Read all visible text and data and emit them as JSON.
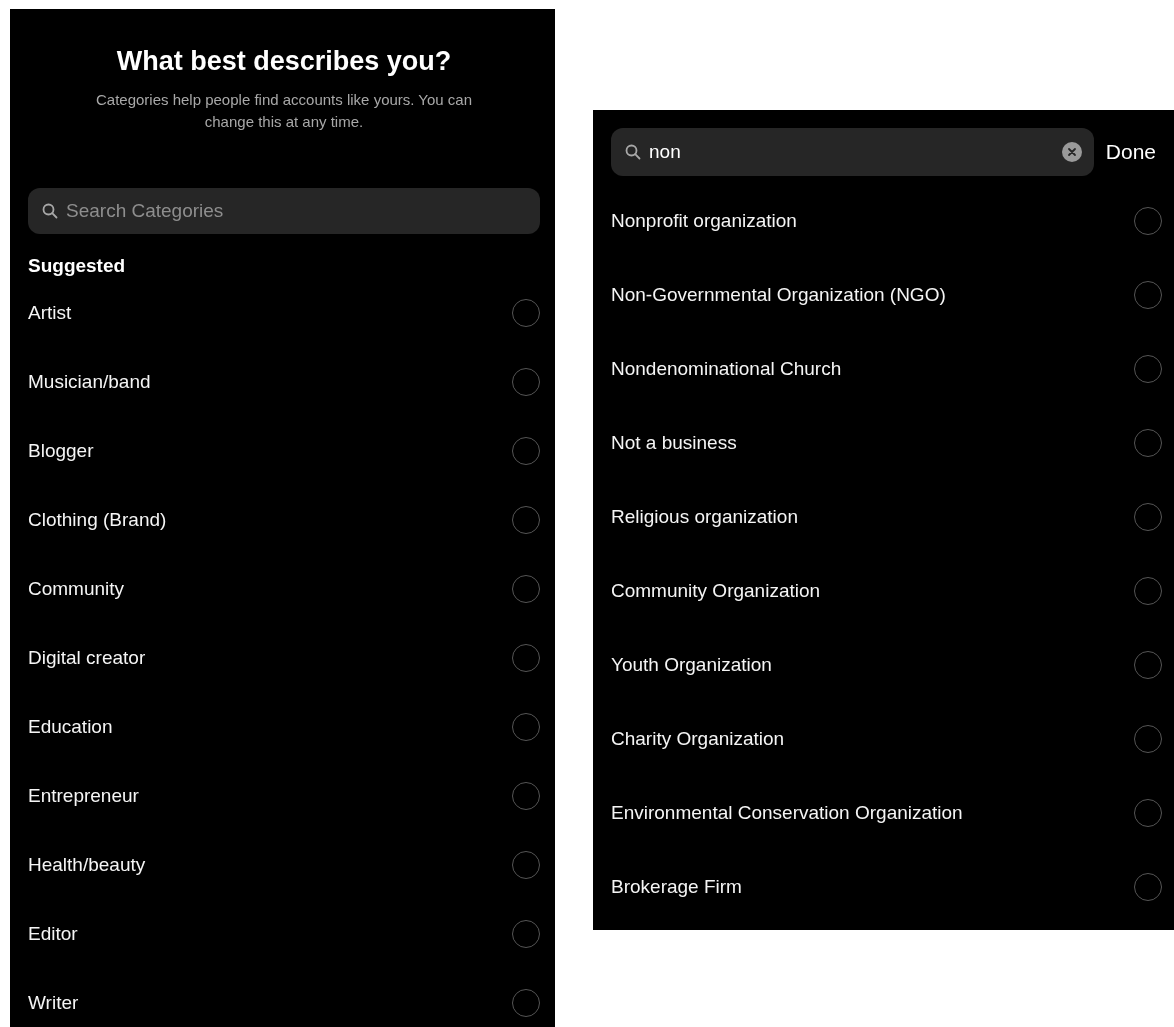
{
  "screens": [
    {
      "title": "What best describes you?",
      "subtitle": "Categories help people find accounts like yours. You can change this at any time.",
      "search": {
        "placeholder": "Search Categories"
      },
      "section_header": "Suggested",
      "options": [
        {
          "label": "Artist",
          "selected": false
        },
        {
          "label": "Musician/band",
          "selected": false
        },
        {
          "label": "Blogger",
          "selected": false
        },
        {
          "label": "Clothing (Brand)",
          "selected": false
        },
        {
          "label": "Community",
          "selected": false
        },
        {
          "label": "Digital creator",
          "selected": false
        },
        {
          "label": "Education",
          "selected": false
        },
        {
          "label": "Entrepreneur",
          "selected": false
        },
        {
          "label": "Health/beauty",
          "selected": false
        },
        {
          "label": "Editor",
          "selected": false
        },
        {
          "label": "Writer",
          "selected": false
        }
      ]
    },
    {
      "search": {
        "value": "non"
      },
      "done_button": "Done",
      "options": [
        {
          "label": "Nonprofit organization",
          "selected": false
        },
        {
          "label": "Non-Governmental Organization (NGO)",
          "selected": false
        },
        {
          "label": "Nondenominational Church",
          "selected": false
        },
        {
          "label": "Not a business",
          "selected": false
        },
        {
          "label": "Religious organization",
          "selected": false
        },
        {
          "label": "Community Organization",
          "selected": false
        },
        {
          "label": "Youth Organization",
          "selected": false
        },
        {
          "label": "Charity Organization",
          "selected": false
        },
        {
          "label": "Environmental Conservation Organization",
          "selected": false
        },
        {
          "label": "Brokerage Firm",
          "selected": false
        }
      ]
    }
  ]
}
